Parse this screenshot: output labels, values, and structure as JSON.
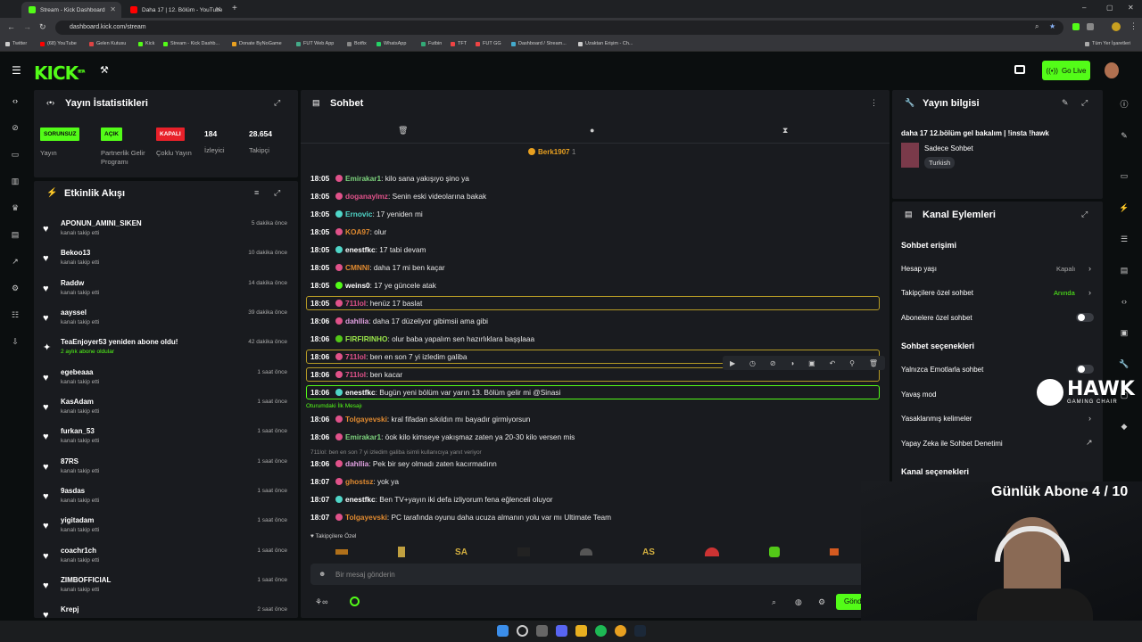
{
  "browser": {
    "tabs": [
      {
        "label": "Stream - Kick Dashboard",
        "color": "#53fc18"
      },
      {
        "label": "Daha 17 | 12. Bölüm - YouTube",
        "color": "#ff0000"
      }
    ],
    "url": "dashboard.kick.com/stream",
    "bookmarks": [
      "Twitter",
      "(68) YouTube",
      "Gelen Kutusu",
      "Kick",
      "Stream - Kick Dashb...",
      "Donate ByNoGame",
      "FUT Web App",
      "Botfix",
      "WhatsApp",
      "Futbin",
      "TFT",
      "FUT GG",
      "Dashboard / Stream...",
      "Uzaktan Erişim - Ch..."
    ],
    "other_bookmarks": "Tüm Yer İşaretleri"
  },
  "header": {
    "logo": "KICK",
    "logo_sup": "BETA",
    "go_live": "Go Live"
  },
  "stats": {
    "title": "Yayın İstatistikleri",
    "badges": [
      {
        "badge": "SORUNSUZ",
        "label": "Yayın",
        "bg": "#53fc18"
      },
      {
        "badge": "AÇIK",
        "label": "Partnerlik Gelir Programı",
        "bg": "#53fc18"
      },
      {
        "badge": "KAPALI",
        "label": "Çoklu Yayın",
        "bg": "#e8212a"
      }
    ],
    "viewers": {
      "value": "184",
      "label": "İzleyici"
    },
    "followers": {
      "value": "28.654",
      "label": "Takipçi"
    }
  },
  "activity": {
    "title": "Etkinlik Akışı",
    "items": [
      {
        "name": "APONUN_AMINI_SIKEN",
        "sub": "kanalı takip etti",
        "time": "5 dakika önce"
      },
      {
        "name": "Bekoo13",
        "sub": "kanalı takip etti",
        "time": "10 dakika önce"
      },
      {
        "name": "Raddw",
        "sub": "kanalı takip etti",
        "time": "14 dakika önce"
      },
      {
        "name": "aayssel",
        "sub": "kanalı takip etti",
        "time": "39 dakika önce"
      },
      {
        "name": "TeaEnjoyer53 yeniden abone oldu!",
        "sub": "2 aylık abone oldular",
        "time": "42 dakika önce"
      },
      {
        "name": "egebeaaa",
        "sub": "kanalı takip etti",
        "time": "1 saat önce"
      },
      {
        "name": "KasAdam",
        "sub": "kanalı takip etti",
        "time": "1 saat önce"
      },
      {
        "name": "furkan_53",
        "sub": "kanalı takip etti",
        "time": "1 saat önce"
      },
      {
        "name": "87RS",
        "sub": "kanalı takip etti",
        "time": "1 saat önce"
      },
      {
        "name": "9asdas",
        "sub": "kanalı takip etti",
        "time": "1 saat önce"
      },
      {
        "name": "yigitadam",
        "sub": "kanalı takip etti",
        "time": "1 saat önce"
      },
      {
        "name": "coachr1ch",
        "sub": "kanalı takip etti",
        "time": "1 saat önce"
      },
      {
        "name": "ZIMBOFFICIAL",
        "sub": "kanalı takip etti",
        "time": "1 saat önce"
      },
      {
        "name": "Krepj",
        "sub": "",
        "time": "2 saat önce"
      }
    ]
  },
  "chat": {
    "title": "Sohbet",
    "pinned_user": "Berk1907",
    "pinned_count": "1",
    "messages": [
      {
        "time": "18:05",
        "user": "Emirakar1",
        "color": "#7cd17c",
        "text": ": kilo sana yakışıyo şino ya"
      },
      {
        "time": "18:05",
        "user": "doganaylmz",
        "color": "#e0528a",
        "text": ": Senin eski videolarına bakak"
      },
      {
        "time": "18:05",
        "user": "Ernovic",
        "color": "#4fd6c8",
        "text": ": 17 yeniden mi"
      },
      {
        "time": "18:05",
        "user": "KOA97",
        "color": "#e08a30",
        "text": ": olur"
      },
      {
        "time": "18:05",
        "user": "enestfkc",
        "color": "#ffffff",
        "text": ": 17 tabi devam"
      },
      {
        "time": "18:05",
        "user": "CMNNI",
        "color": "#e08a30",
        "text": ": daha 17 mi ben kaçar"
      },
      {
        "time": "18:05",
        "user": "weins0",
        "color": "#ffffff",
        "text": ": 17 ye güncele atak"
      },
      {
        "time": "18:05",
        "user": "711lol",
        "color": "#e0528a",
        "text": ": henüz 17 baslat"
      },
      {
        "time": "18:06",
        "user": "dahllia",
        "color": "#e0a0e0",
        "text": ": daha 17 düzeliyor gibimsii ama gibi"
      },
      {
        "time": "18:06",
        "user": "FIRFIRINHO",
        "color": "#9ae64a",
        "text": ": olur baba yapalım sen hazırlıklara başşlaaa"
      },
      {
        "time": "18:06",
        "user": "711lol",
        "color": "#e0528a",
        "text": ": ben en son 7 yi izledim galiba"
      },
      {
        "time": "18:06",
        "user": "711lol",
        "color": "#e0528a",
        "text": ": ben kacar"
      },
      {
        "time": "18:06",
        "user": "enestfkc",
        "color": "#ffffff",
        "text": ": Bugün yeni bölüm var yarın 13. Bölüm gelir mi @Sinasi"
      },
      {
        "time": "18:06",
        "user": "Tolgayevski",
        "color": "#e08a30",
        "text": ": kral fifadan sıkıldın mı bayadır girmiyorsun"
      },
      {
        "time": "18:06",
        "user": "Emirakar1",
        "color": "#7cd17c",
        "text": ": öok kilo kimseye yakışmaz zaten ya 20-30 kilo versen mis"
      },
      {
        "time": "18:06",
        "user": "dahllia",
        "color": "#e0a0e0",
        "text": ": Pek bir sey olmadı zaten kacırmadınn"
      },
      {
        "time": "18:07",
        "user": "ghostsz",
        "color": "#e08a30",
        "text": ": yok ya"
      },
      {
        "time": "18:07",
        "user": "enestfkc",
        "color": "#ffffff",
        "text": ": Ben TV+yayın iki defa izliyorum fena eğlenceli oluyor"
      },
      {
        "time": "18:07",
        "user": "Tolgayevski",
        "color": "#e08a30",
        "text": ": PC tarafında oyunu daha ucuza almanın yolu var mı Ultimate Team"
      }
    ],
    "first_message_label": "Oturumdaki İlk Mesajı",
    "reply_label": "711lol: ben en son 7 yi izledim galiba isimli kullanıcıya yanıt veriyor",
    "emote_section": "Takipçilere Özel",
    "input_placeholder": "Bir mesaj gönderin",
    "send_label": "Gönder"
  },
  "info": {
    "title": "Yayın bilgisi",
    "stream_title": "daha 17 12.bölüm gel bakalım | !insta !hawk",
    "category": "Sadece Sohbet",
    "language": "Turkish"
  },
  "actions": {
    "title": "Kanal Eylemleri",
    "chat_access": "Sohbet erişimi",
    "account_age": {
      "label": "Hesap yaşı",
      "value": "Kapalı"
    },
    "followers_only": {
      "label": "Takipçilere özel sohbet",
      "value": "Anında"
    },
    "subs_only": "Abonelere özel sohbet",
    "chat_options": "Sohbet seçenekleri",
    "emotes_only": "Yalnızca Emotlarla sohbet",
    "slow_mode": "Yavaş mod",
    "banned_words": "Yasaklanmış kelimeler",
    "ai_moderation": "Yapay Zeka ile Sohbet Denetimi",
    "channel_options": "Kanal seçenekleri"
  },
  "overlay": {
    "sub_goal": "Günlük Abone 4 / 10",
    "sponsor": "HAWK",
    "sponsor_sub": "GAMING CHAIR"
  }
}
